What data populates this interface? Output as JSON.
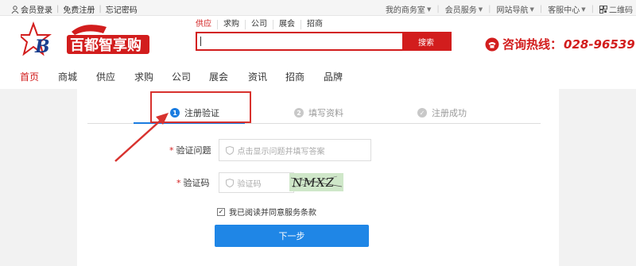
{
  "topbar": {
    "login": "会员登录",
    "register": "免费注册",
    "forgot": "忘记密码",
    "right_items": [
      "我的商务室",
      "会员服务",
      "网站导航",
      "客服中心",
      "二维码"
    ]
  },
  "logo": {
    "text": "百都智享购",
    "mark": "B"
  },
  "search": {
    "tabs": [
      "供应",
      "求购",
      "公司",
      "展会",
      "招商"
    ],
    "placeholder": "",
    "button": "搜索"
  },
  "hotline": {
    "label": "咨询热线：",
    "number": "028-96539"
  },
  "nav": [
    "首页",
    "商城",
    "供应",
    "求购",
    "公司",
    "展会",
    "资讯",
    "招商",
    "品牌"
  ],
  "steps": [
    {
      "num": "1",
      "label": "注册验证",
      "active": true
    },
    {
      "num": "2",
      "label": "填写资料",
      "active": false
    },
    {
      "num": "✓",
      "label": "注册成功",
      "active": false
    }
  ],
  "form": {
    "question_label": "验证问题",
    "question_placeholder": "点击显示问题并填写答案",
    "code_label": "验证码",
    "code_placeholder": "验证码",
    "captcha_text": "NMXZ",
    "agree_text": "我已阅读并同意服务条款",
    "agree_checked": true,
    "next_button": "下一步"
  },
  "colors": {
    "brand_red": "#d21d1d",
    "accent_blue": "#1f86e6",
    "annotation_red": "#d8322e"
  }
}
